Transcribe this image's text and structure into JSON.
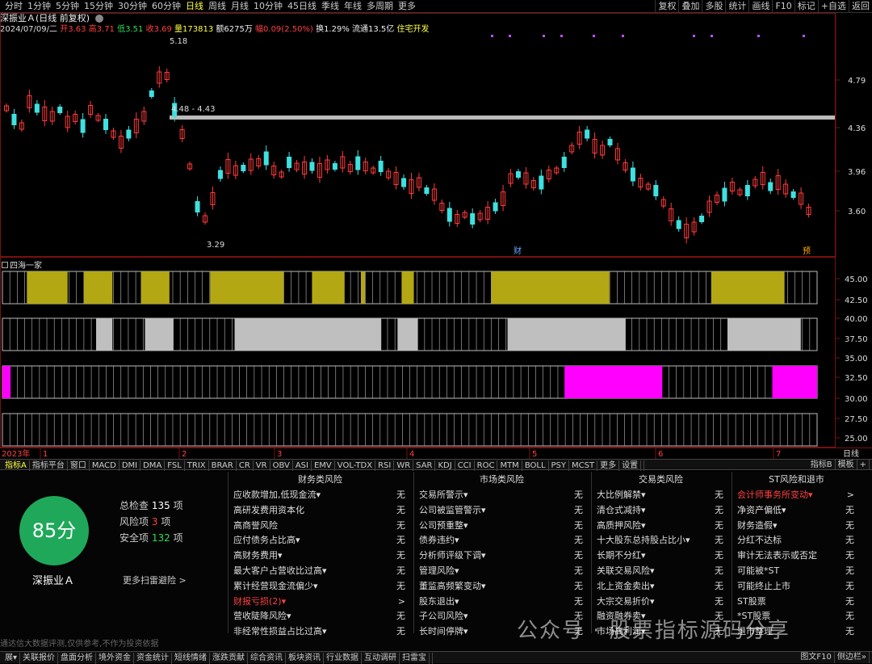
{
  "toolbar": {
    "periods": [
      "分时",
      "1分钟",
      "5分钟",
      "15分钟",
      "30分钟",
      "60分钟",
      "日线",
      "周线",
      "月线",
      "10分钟",
      "45日线",
      "季线",
      "年线",
      "多周期",
      "更多"
    ],
    "active_period": "日线",
    "right": [
      "复权",
      "叠加",
      "多股",
      "统计",
      "画线",
      "F10",
      "标记",
      "+自选",
      "返回"
    ]
  },
  "stock": {
    "title": "深振业Ａ(日线 前复权)",
    "date": "2024/07/09/二",
    "open_label": "开",
    "open": "3.63",
    "high_label": "高",
    "high": "3.71",
    "low_label": "低",
    "low": "3.51",
    "close_label": "收",
    "close": "3.69",
    "vol_label": "量",
    "vol": "173813",
    "amt_label": "额",
    "amt": "6275万",
    "chg_label": "幅",
    "chg": "0.09(2.50%)",
    "turn_label": "换",
    "turn": "1.29%",
    "float_label": "流通",
    "float": "13.5亿",
    "sector": "住宅开发"
  },
  "chart_data": {
    "type": "candlestick",
    "y_ticks": [
      "4.79",
      "4.36",
      "3.96",
      "3.60"
    ],
    "annotations": [
      "5.18",
      "4.48 - 4.43",
      "3.29"
    ],
    "markers": [
      "财",
      "预"
    ]
  },
  "indicator": {
    "name": "四海一家",
    "y_ticks": [
      "45.00",
      "42.50",
      "40.00",
      "37.50",
      "35.00",
      "32.50",
      "30.00",
      "27.50",
      "25.00"
    ],
    "rows": [
      {
        "color": "#b3a814",
        "blocks": [
          [
            0.03,
            0.08
          ],
          [
            0.1,
            0.135
          ],
          [
            0.17,
            0.205
          ],
          [
            0.255,
            0.345
          ],
          [
            0.38,
            0.42
          ],
          [
            0.44,
            0.445
          ],
          [
            0.49,
            0.505
          ],
          [
            0.6,
            0.745
          ],
          [
            0.87,
            0.96
          ]
        ]
      },
      {
        "color": "#bfbfbf",
        "blocks": [
          [
            0.115,
            0.135
          ],
          [
            0.175,
            0.21
          ],
          [
            0.285,
            0.465
          ],
          [
            0.485,
            0.51
          ],
          [
            0.62,
            0.765
          ],
          [
            0.89,
            0.98
          ]
        ]
      },
      {
        "color": "#ff00ff",
        "blocks": [
          [
            0.0,
            0.01
          ],
          [
            0.69,
            0.81
          ],
          [
            0.945,
            1.0
          ]
        ]
      },
      {
        "color": "#888888",
        "blocks": []
      }
    ]
  },
  "xaxis": {
    "year": "2023年",
    "months": [
      "1",
      "2",
      "3",
      "4",
      "5",
      "6",
      "7"
    ],
    "period": "日线"
  },
  "tabs": [
    "指标A",
    "指标平台",
    "窗口",
    "MACD",
    "DMI",
    "DMA",
    "FSL",
    "TRIX",
    "BRAR",
    "CR",
    "VR",
    "OBV",
    "ASI",
    "EMV",
    "VOL-TDX",
    "RSI",
    "WR",
    "SAR",
    "KDJ",
    "CCI",
    "ROC",
    "MTM",
    "BOLL",
    "PSY",
    "MCST",
    "更多",
    "设置"
  ],
  "tabs_right": [
    "指标B",
    "模板",
    "+"
  ],
  "risk": {
    "score": "85分",
    "total_label": "总检查",
    "total": "135",
    "total_unit": "项",
    "risk_label": "风险项",
    "risk": "3",
    "risk_unit": "项",
    "safe_label": "安全项",
    "safe": "132",
    "safe_unit": "项",
    "name": "深振业Ａ",
    "more": "更多扫雷避险 >",
    "disclaimer": "通达信大数据评测,仅供参考,不作为投资依据",
    "columns": [
      {
        "title": "财务类风险",
        "items": [
          {
            "label": "应收款增加,低现金流▾",
            "status": "无"
          },
          {
            "label": "高研发费用资本化",
            "status": "无"
          },
          {
            "label": "高商誉风险",
            "status": "无"
          },
          {
            "label": "应付债务占比高▾",
            "status": "无"
          },
          {
            "label": "高财务费用▾",
            "status": "无"
          },
          {
            "label": "最大客户占营收比过高▾",
            "status": "无"
          },
          {
            "label": "累计经营现金流偏少▾",
            "status": "无"
          },
          {
            "label": "财报亏损(2)▾",
            "status": ">",
            "alert": true
          },
          {
            "label": "营收陡降风险▾",
            "status": "无"
          },
          {
            "label": "非经常性损益占比过高▾",
            "status": "无"
          }
        ]
      },
      {
        "title": "市场类风险",
        "items": [
          {
            "label": "交易所警示▾",
            "status": "无"
          },
          {
            "label": "公司被监管警示▾",
            "status": "无"
          },
          {
            "label": "公司预重整▾",
            "status": "无"
          },
          {
            "label": "债券违约▾",
            "status": "无"
          },
          {
            "label": "分析师评级下调▾",
            "status": "无"
          },
          {
            "label": "管理风险▾",
            "status": "无"
          },
          {
            "label": "董监高频繁变动▾",
            "status": "无"
          },
          {
            "label": "股东退出▾",
            "status": "无"
          },
          {
            "label": "子公司风险▾",
            "status": "无"
          },
          {
            "label": "长时间停牌▾",
            "status": "无"
          }
        ]
      },
      {
        "title": "交易类风险",
        "items": [
          {
            "label": "大比例解禁▾",
            "status": "无"
          },
          {
            "label": "清仓式减持▾",
            "status": "无"
          },
          {
            "label": "高质押风险▾",
            "status": "无"
          },
          {
            "label": "十大股东总持股占比小▾",
            "status": "无"
          },
          {
            "label": "长期不分红▾",
            "status": "无"
          },
          {
            "label": "关联交易风险▾",
            "status": "无"
          },
          {
            "label": "北上资金卖出▾",
            "status": "无"
          },
          {
            "label": "大宗交易折价▾",
            "status": "无"
          },
          {
            "label": "融资融券卖▾",
            "status": "无"
          },
          {
            "label": "市场高利润▾",
            "status": "无"
          }
        ]
      },
      {
        "title": "ST风险和退市",
        "items": [
          {
            "label": "会计师事务所变动▾",
            "status": ">",
            "alert": true
          },
          {
            "label": "净资产偏低▾",
            "status": "无"
          },
          {
            "label": "财务造假▾",
            "status": "无"
          },
          {
            "label": "分红不达标",
            "status": "无"
          },
          {
            "label": "审计无法表示或否定",
            "status": "无"
          },
          {
            "label": "可能被*ST",
            "status": "无"
          },
          {
            "label": "可能终止上市",
            "status": "无"
          },
          {
            "label": "ST股票",
            "status": "无"
          },
          {
            "label": "*ST股票",
            "status": "无"
          },
          {
            "label": "退市整理",
            "status": "无"
          }
        ]
      }
    ]
  },
  "bottom": [
    "展▾",
    "关联报价",
    "盘面分析",
    "境外资金",
    "资金统计",
    "短线情绪",
    "涨跌贡献",
    "综合资讯",
    "板块资讯",
    "行业数据",
    "互动调研",
    "扫雷宝"
  ],
  "bottom_right": [
    "图文F10",
    "侧边栏»"
  ],
  "watermark": "公众号 · 股票指标源码分享"
}
